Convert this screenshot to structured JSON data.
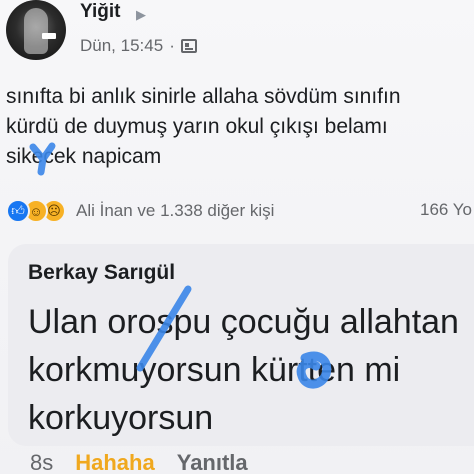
{
  "post": {
    "author": "Yiğit",
    "author_arrow": "▶",
    "time": "Dün, 15:45",
    "separator": "·",
    "privacy_icon": "friends-icon",
    "text_lines": [
      "sınıfta bi anlık sinirle allaha sövdüm sınıfın",
      "kürdü de duymuş yarın okul çıkışı belamı",
      "sikecek napicam"
    ]
  },
  "reactions": {
    "icons": [
      "like-icon",
      "haha-icon",
      "sad-icon"
    ],
    "summary": "Ali İnan ve 1.338 diğer kişi",
    "comments": "166 Yo"
  },
  "comment": {
    "author": "Berkay Sarıgül",
    "text_lines": [
      "Ulan orospu çocuğu allahtan",
      "korkmuyorsun kürtten mi",
      "korkuyorsun"
    ]
  },
  "comment_actions": {
    "time": "8s",
    "reaction": "Hahaha",
    "reply": "Yanıtla"
  },
  "colors": {
    "link_blue": "#1877f2",
    "haha_yellow": "#f0a81e",
    "scribble": "#3b86e8"
  }
}
